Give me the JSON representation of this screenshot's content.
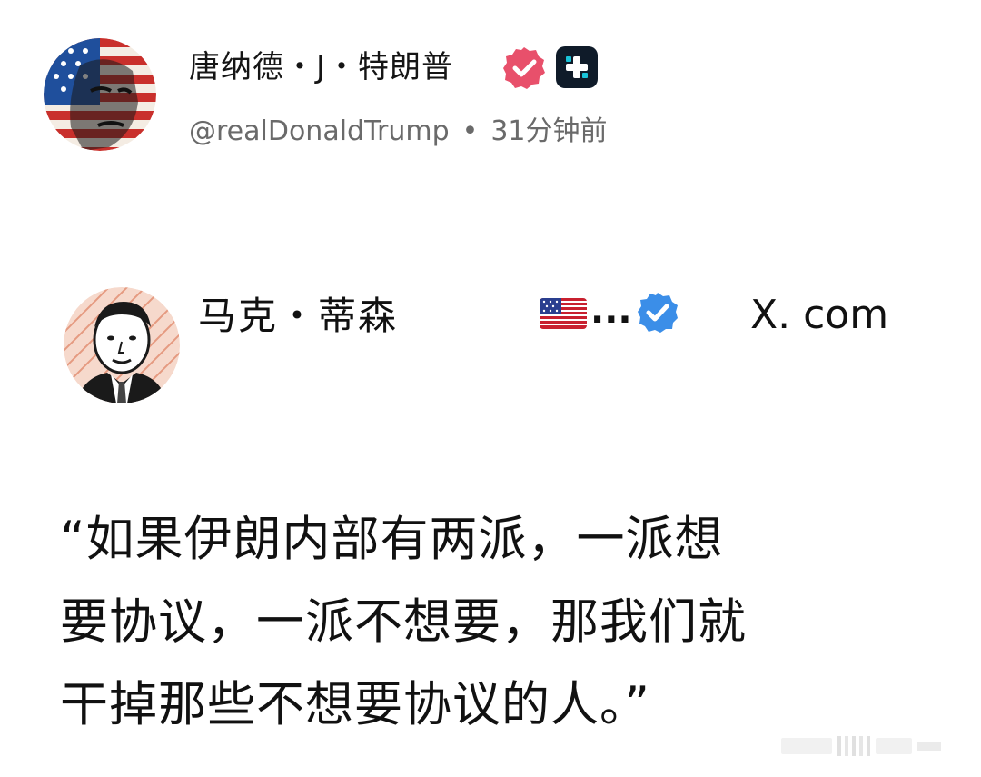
{
  "post": {
    "author_name": "唐纳德・J・特朗普",
    "handle": "@realDonaldTrump",
    "separator": "•",
    "time_ago": "31分钟前",
    "badges": [
      "verified-badge-icon",
      "truth-plus-icon"
    ],
    "verified_color": "#e8506b",
    "plus_color": "#0f1b29"
  },
  "quoted": {
    "name": "马克・蒂森",
    "flag": "us-flag-icon",
    "ellipsis": "...",
    "verified_color": "#3b8ee8",
    "source": "X. com"
  },
  "quote": {
    "lines": [
      "“如果伊朗内部有两派，一派想",
      "要协议，一派不想要，那我们就",
      "干掉那些不想要协议的人。”"
    ]
  },
  "colors": {
    "background": "#ffffff",
    "text": "#111111",
    "muted": "#6a6a6a"
  }
}
